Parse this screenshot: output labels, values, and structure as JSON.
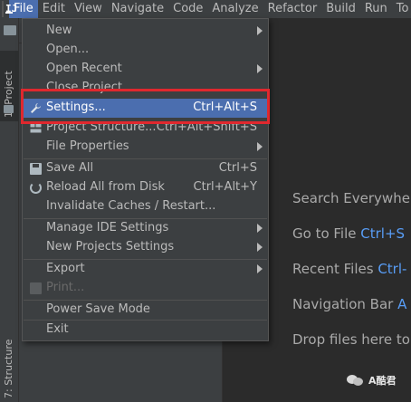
{
  "menubar": {
    "items": [
      "File",
      "Edit",
      "View",
      "Navigate",
      "Code",
      "Analyze",
      "Refactor",
      "Build",
      "Run",
      "To"
    ],
    "active_index": 0
  },
  "toolstrip": {
    "project_tab": "1: Project",
    "structure_tab": "7: Structure"
  },
  "file_menu": {
    "items": [
      {
        "label": "New",
        "shortcut": "",
        "submenu": true
      },
      {
        "label": "Open...",
        "shortcut": "",
        "submenu": false
      },
      {
        "label": "Open Recent",
        "shortcut": "",
        "submenu": true
      },
      {
        "label": "Close Project",
        "shortcut": "",
        "submenu": false
      },
      {
        "label": "Settings...",
        "shortcut": "Ctrl+Alt+S",
        "submenu": false
      },
      {
        "label": "Project Structure...",
        "shortcut": "Ctrl+Alt+Shift+S",
        "submenu": false
      },
      {
        "label": "File Properties",
        "shortcut": "",
        "submenu": true
      },
      {
        "label": "Save All",
        "shortcut": "Ctrl+S",
        "submenu": false
      },
      {
        "label": "Reload All from Disk",
        "shortcut": "Ctrl+Alt+Y",
        "submenu": false
      },
      {
        "label": "Invalidate Caches / Restart...",
        "shortcut": "",
        "submenu": false
      },
      {
        "label": "Manage IDE Settings",
        "shortcut": "",
        "submenu": true
      },
      {
        "label": "New Projects Settings",
        "shortcut": "",
        "submenu": true
      },
      {
        "label": "Export",
        "shortcut": "",
        "submenu": true
      },
      {
        "label": "Print...",
        "shortcut": "",
        "submenu": false
      },
      {
        "label": "Power Save Mode",
        "shortcut": "",
        "submenu": false
      },
      {
        "label": "Exit",
        "shortcut": "",
        "submenu": false
      }
    ],
    "selected_label": "Settings...",
    "disabled_label": "Print..."
  },
  "editor_hints": {
    "search_everywhere": "Search Everywher",
    "go_to_file": "Go to File",
    "go_to_file_key": "Ctrl+S",
    "recent_files": "Recent Files",
    "recent_files_key": "Ctrl-",
    "navigation_bar": "Navigation Bar",
    "navigation_bar_key": "A",
    "drop_files": "Drop files here to"
  },
  "watermark": {
    "text": "A酷君"
  },
  "colors": {
    "menu_bg": "#3c3f41",
    "editor_bg": "#2b2b2b",
    "selection": "#4b6eaf",
    "highlight_border": "#e0282e",
    "shortcut_key": "#589df6"
  }
}
